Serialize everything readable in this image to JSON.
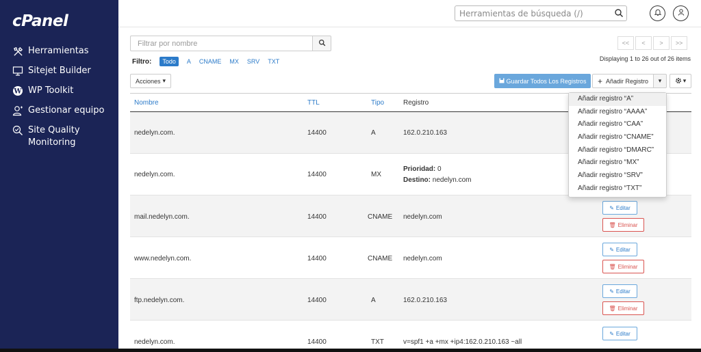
{
  "app": {
    "logo": "cPanel"
  },
  "sidebar": {
    "items": [
      {
        "label": "Herramientas",
        "icon": "tools-icon"
      },
      {
        "label": "Sitejet Builder",
        "icon": "sitejet-icon"
      },
      {
        "label": "WP Toolkit",
        "icon": "wordpress-icon"
      },
      {
        "label": "Gestionar equipo",
        "icon": "team-icon"
      },
      {
        "label": "Site Quality Monitoring",
        "icon": "quality-icon"
      }
    ]
  },
  "header": {
    "search_placeholder": "Herramientas de búsqueda (/)"
  },
  "filter": {
    "placeholder": "Filtrar por nombre",
    "label": "Filtro:",
    "tags": [
      "Todo",
      "A",
      "CNAME",
      "MX",
      "SRV",
      "TXT"
    ]
  },
  "pager": {
    "buttons": [
      "<<",
      "<",
      ">",
      ">>"
    ],
    "display_text": "Displaying 1 to 26 out of 26 items"
  },
  "toolbar": {
    "actions_label": "Acciones",
    "save_all_label": "Guardar Todos Los Registros",
    "add_record_label": "Añadir Registro"
  },
  "table": {
    "headers": [
      "Nombre",
      "TTL",
      "Tipo",
      "Registro"
    ],
    "rows": [
      {
        "name": "nedelyn.com.",
        "ttl": "14400",
        "type": "A",
        "record": "162.0.210.163"
      },
      {
        "name": "nedelyn.com.",
        "ttl": "14400",
        "type": "MX",
        "priority_label": "Prioridad:",
        "priority": "0",
        "dest_label": "Destino:",
        "dest": "nedelyn.com"
      },
      {
        "name": "mail.nedelyn.com.",
        "ttl": "14400",
        "type": "CNAME",
        "record": "nedelyn.com"
      },
      {
        "name": "www.nedelyn.com.",
        "ttl": "14400",
        "type": "CNAME",
        "record": "nedelyn.com"
      },
      {
        "name": "ftp.nedelyn.com.",
        "ttl": "14400",
        "type": "A",
        "record": "162.0.210.163"
      },
      {
        "name": "nedelyn.com.",
        "ttl": "14400",
        "type": "TXT",
        "record": "v=spf1 +a +mx +ip4:162.0.210.163 ~all"
      }
    ],
    "edit_label": "Editar",
    "delete_label": "Eliminar"
  },
  "dropdown": {
    "items": [
      "Añadir registro “A”",
      "Añadir registro “AAAA”",
      "Añadir registro “CAA”",
      "Añadir registro “CNAME”",
      "Añadir registro “DMARC”",
      "Añadir registro “MX”",
      "Añadir registro “SRV”",
      "Añadir registro “TXT”"
    ]
  },
  "colors": {
    "sidebar": "#1b2456",
    "link": "#2c7bc9",
    "primary_button": "#6aa7dc",
    "danger": "#d9534f"
  }
}
